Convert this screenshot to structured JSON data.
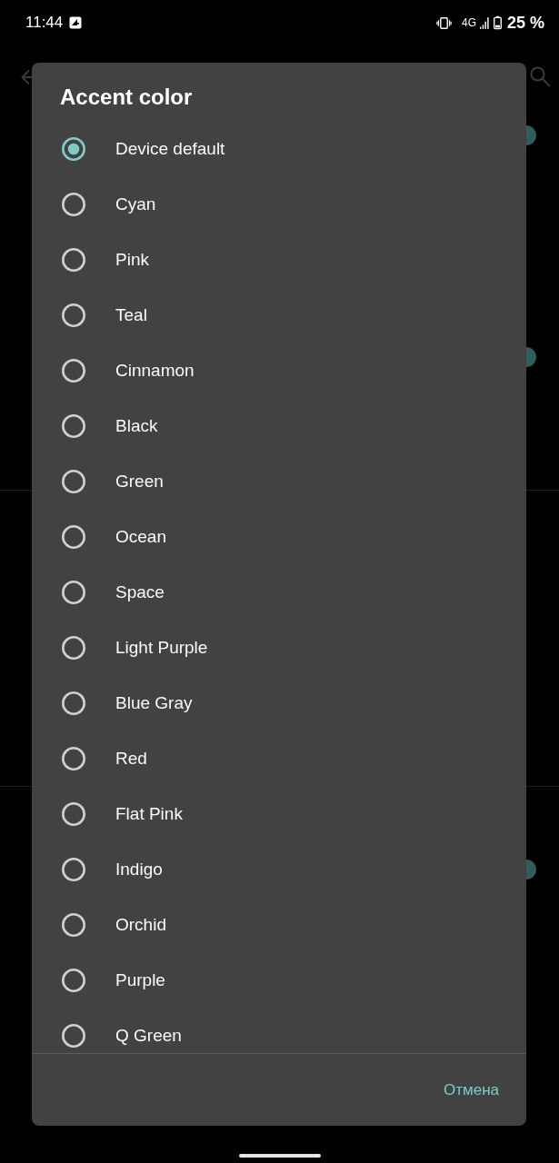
{
  "status_bar": {
    "time": "11:44",
    "network": "4G",
    "battery": "25 %"
  },
  "background": {
    "switches": [
      {
        "on": true
      },
      {
        "on": true
      },
      {
        "on": true
      }
    ]
  },
  "dialog": {
    "title": "Accent color",
    "options": [
      {
        "label": "Device default",
        "selected": true
      },
      {
        "label": "Cyan",
        "selected": false
      },
      {
        "label": "Pink",
        "selected": false
      },
      {
        "label": "Teal",
        "selected": false
      },
      {
        "label": "Cinnamon",
        "selected": false
      },
      {
        "label": "Black",
        "selected": false
      },
      {
        "label": "Green",
        "selected": false
      },
      {
        "label": "Ocean",
        "selected": false
      },
      {
        "label": "Space",
        "selected": false
      },
      {
        "label": "Light Purple",
        "selected": false
      },
      {
        "label": "Blue Gray",
        "selected": false
      },
      {
        "label": "Red",
        "selected": false
      },
      {
        "label": "Flat Pink",
        "selected": false
      },
      {
        "label": "Indigo",
        "selected": false
      },
      {
        "label": "Orchid",
        "selected": false
      },
      {
        "label": "Purple",
        "selected": false
      },
      {
        "label": "Q Green",
        "selected": false
      }
    ],
    "buttons": [
      {
        "kind": "text",
        "label": "Отмена"
      }
    ]
  }
}
